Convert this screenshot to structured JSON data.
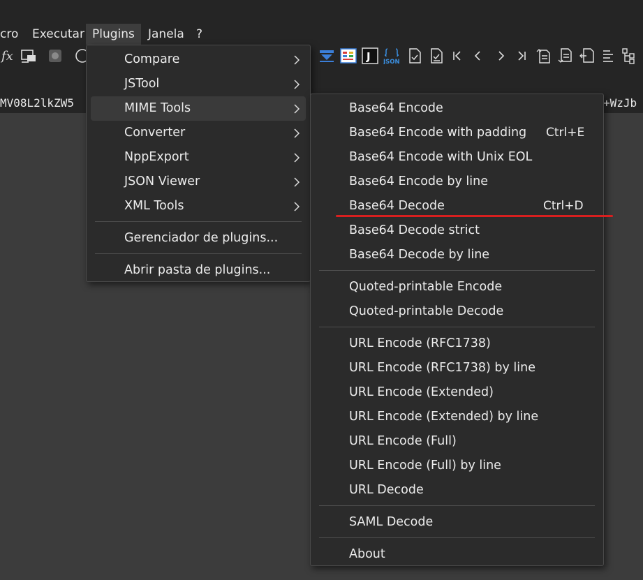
{
  "menubar": {
    "items": [
      "cro",
      "Executar",
      "Plugins",
      "Janela",
      "?"
    ],
    "active": "Plugins"
  },
  "toolbar": {
    "left_icons": [
      "function-icon",
      "run-macro-icon",
      "record-icon",
      "circle-icon"
    ],
    "right_icons": [
      "compare-icon",
      "diff-panel-icon",
      "jstool-icon",
      "json-viewer-icon",
      "doc-check-icon",
      "doc-check2-icon",
      "first-icon",
      "prev-icon",
      "next-icon",
      "last-icon",
      "doc-up-icon",
      "doc-down-icon",
      "doc-left-icon",
      "list-icon",
      "tree-icon"
    ],
    "json_text": "JSON",
    "j_text": "J"
  },
  "editor": {
    "line_left": "MV08L2lkZW5",
    "line_right": "+WzJb"
  },
  "plugins_menu": {
    "items": [
      {
        "label": "Compare",
        "submenu": true
      },
      {
        "label": "JSTool",
        "submenu": true
      },
      {
        "label": "MIME Tools",
        "submenu": true,
        "highlighted": true
      },
      {
        "label": "Converter",
        "submenu": true
      },
      {
        "label": "NppExport",
        "submenu": true
      },
      {
        "label": "JSON Viewer",
        "submenu": true
      },
      {
        "label": "XML Tools",
        "submenu": true
      }
    ],
    "footer": [
      {
        "label": "Gerenciador de plugins..."
      },
      {
        "label": "Abrir pasta de plugins..."
      }
    ]
  },
  "mime_menu": {
    "group1": [
      {
        "label": "Base64 Encode",
        "shortcut": ""
      },
      {
        "label": "Base64 Encode with padding",
        "shortcut": "Ctrl+E"
      },
      {
        "label": "Base64 Encode with Unix EOL",
        "shortcut": ""
      },
      {
        "label": "Base64 Encode by line",
        "shortcut": ""
      },
      {
        "label": "Base64 Decode",
        "shortcut": "Ctrl+D"
      },
      {
        "label": "Base64 Decode strict",
        "shortcut": ""
      },
      {
        "label": "Base64 Decode by line",
        "shortcut": ""
      }
    ],
    "group2": [
      {
        "label": "Quoted-printable Encode"
      },
      {
        "label": "Quoted-printable Decode"
      }
    ],
    "group3": [
      {
        "label": "URL Encode (RFC1738)"
      },
      {
        "label": "URL Encode (RFC1738) by line"
      },
      {
        "label": "URL Encode (Extended)"
      },
      {
        "label": "URL Encode (Extended) by line"
      },
      {
        "label": "URL Encode (Full)"
      },
      {
        "label": "URL Encode (Full) by line"
      },
      {
        "label": "URL Decode"
      }
    ],
    "group4": [
      {
        "label": "SAML Decode"
      }
    ],
    "group5": [
      {
        "label": "About"
      }
    ]
  },
  "colors": {
    "background": "#3c3c3c",
    "chrome": "#252525",
    "menu": "#2b2b2b",
    "highlight": "#3a3a3a",
    "annotation_red": "#d81f1f"
  }
}
